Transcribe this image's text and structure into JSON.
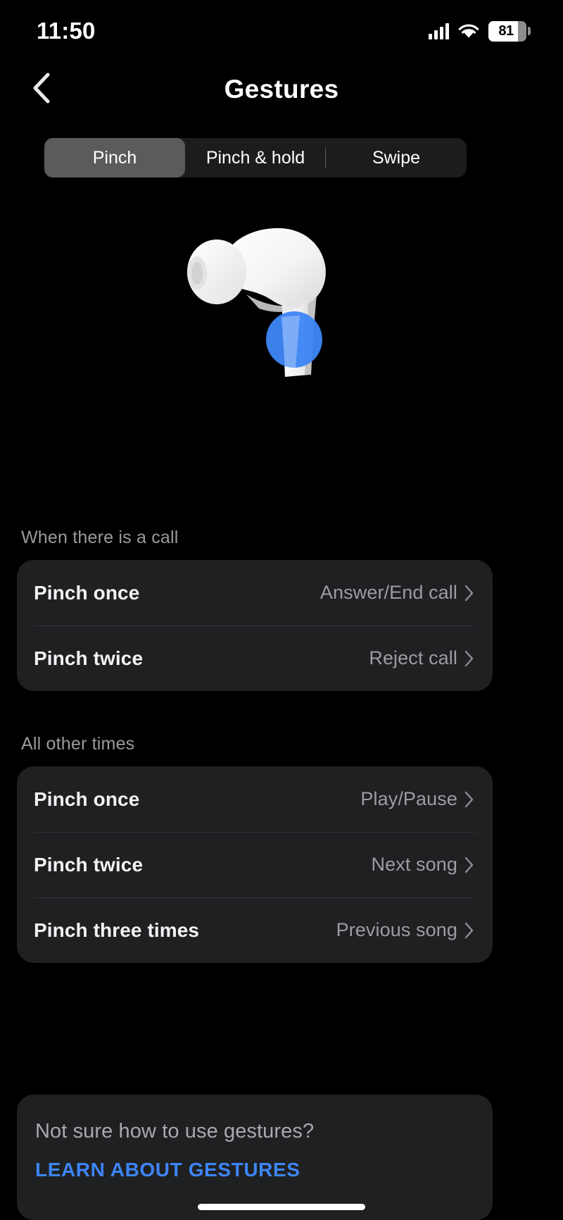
{
  "status_bar": {
    "time": "11:50",
    "battery_level": "81",
    "icons": [
      "signal-icon",
      "wifi-icon",
      "battery-icon"
    ]
  },
  "header": {
    "title": "Gestures",
    "back_icon": "chevron-left-icon"
  },
  "segmented_control": {
    "selected": "Pinch",
    "tabs": [
      {
        "label": "Pinch",
        "selected": true
      },
      {
        "label": "Pinch & hold",
        "selected": false
      },
      {
        "label": "Swipe",
        "selected": false
      }
    ]
  },
  "hero": {
    "image": "earbud-illustration",
    "highlight_color": "#3d85f5"
  },
  "sections": [
    {
      "label": "When there is a call",
      "rows": [
        {
          "title": "Pinch once",
          "value": "Answer/End call",
          "chevron": "chevron-right-icon"
        },
        {
          "title": "Pinch twice",
          "value": "Reject call",
          "chevron": "chevron-right-icon"
        }
      ]
    },
    {
      "label": "All other times",
      "rows": [
        {
          "title": "Pinch once",
          "value": "Play/Pause",
          "chevron": "chevron-right-icon"
        },
        {
          "title": "Pinch twice",
          "value": "Next song",
          "chevron": "chevron-right-icon"
        },
        {
          "title": "Pinch three times",
          "value": "Previous song",
          "chevron": "chevron-right-icon"
        }
      ]
    }
  ],
  "learn_card": {
    "question": "Not sure how to use gestures?",
    "link_label": "LEARN ABOUT GESTURES",
    "link_color": "#3d85f5"
  },
  "colors": {
    "background": "#000000",
    "card": "#1f2022",
    "selected_segment": "#5b5b5d",
    "secondary_text": "#9a9a9e",
    "accent": "#3d85f5"
  }
}
